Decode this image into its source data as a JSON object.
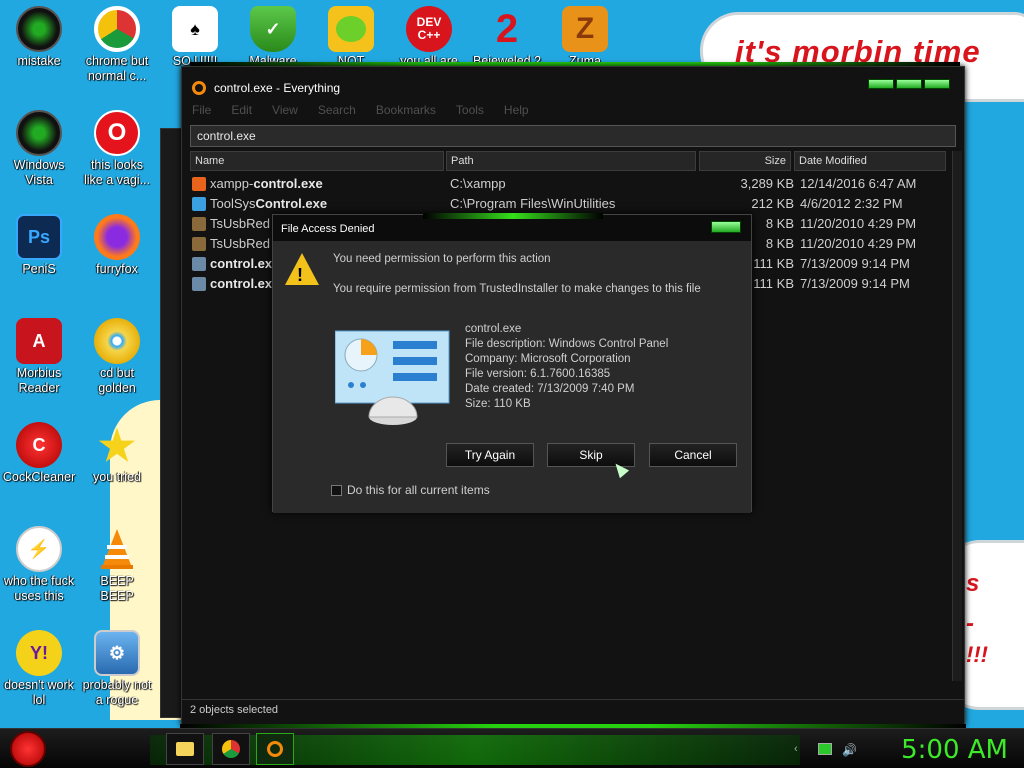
{
  "desktop": {
    "cloud_text": "it's morbin time",
    "cloud2_lines": [
      "s",
      "-",
      "!!!"
    ],
    "icons": [
      {
        "label": "mistake",
        "x": 0,
        "y": 0
      },
      {
        "label": "chrome but\nnormal c..."
      },
      {
        "label": "SO U!!!!"
      },
      {
        "label": "Malware"
      },
      {
        "label": "NOT"
      },
      {
        "label": "you all are"
      },
      {
        "label": "Bejeweled 2"
      },
      {
        "label": "Zuma"
      },
      {
        "label": "Windows\nVista"
      },
      {
        "label": "this looks\nlike a vagi..."
      },
      {
        "label": "PeniS"
      },
      {
        "label": "furryfox"
      },
      {
        "label": "Morbius\nReader"
      },
      {
        "label": "cd but\ngolden"
      },
      {
        "label": "CockCleaner"
      },
      {
        "label": "you tried"
      },
      {
        "label": "who the fuck\nuses this"
      },
      {
        "label": "BEEP\nBEEP"
      },
      {
        "label": "doesn't work\nlol"
      },
      {
        "label": "probably not\na rogue"
      }
    ]
  },
  "everything": {
    "title": "control.exe - Everything",
    "menu": [
      "File",
      "Edit",
      "View",
      "Search",
      "Bookmarks",
      "Tools",
      "Help"
    ],
    "search_value": "control.exe",
    "columns": {
      "name": "Name",
      "path": "Path",
      "size": "Size",
      "date": "Date Modified"
    },
    "rows": [
      {
        "name_pre": "xampp-",
        "name_bold": "control.exe",
        "path": "C:\\xampp",
        "size": "3,289 KB",
        "date": "12/14/2016 6:47 AM",
        "color": "#e8641c"
      },
      {
        "name_pre": "ToolSys",
        "name_bold": "Control.exe",
        "path": "C:\\Program Files\\WinUtilities",
        "size": "212 KB",
        "date": "4/6/2012 2:32 PM",
        "color": "#3aa0e0"
      },
      {
        "name_pre": "TsUsbRed",
        "name_bold": "",
        "path": "",
        "size": "8 KB",
        "date": "11/20/2010 4:29 PM",
        "color": "#8a6a3a"
      },
      {
        "name_pre": "TsUsbRed",
        "name_bold": "",
        "path": "",
        "size": "8 KB",
        "date": "11/20/2010 4:29 PM",
        "color": "#8a6a3a"
      },
      {
        "name_pre": "",
        "name_bold": "control.ex",
        "path": "",
        "size": "111 KB",
        "date": "7/13/2009 9:14 PM",
        "color": "#6a8aa8"
      },
      {
        "name_pre": "",
        "name_bold": "control.ex",
        "path": "",
        "size": "111 KB",
        "date": "7/13/2009 9:14 PM",
        "color": "#6a8aa8"
      }
    ],
    "status": "2 objects selected"
  },
  "dialog": {
    "title": "File Access Denied",
    "line1": "You need permission to perform this action",
    "line2": "You require permission from TrustedInstaller to make changes to this file",
    "file_name": "control.exe",
    "desc": "File description: Windows Control Panel",
    "company": "Company: Microsoft Corporation",
    "version": "File version: 6.1.7600.16385",
    "created": "Date created: 7/13/2009 7:40 PM",
    "size": "Size: 110 KB",
    "btn_try": "Try Again",
    "btn_skip": "Skip",
    "btn_cancel": "Cancel",
    "checkbox_label": "Do this for all current items"
  },
  "taskbar": {
    "clock": "5:00 AM"
  },
  "colors": {
    "accent_green": "#26d10f",
    "cloud_red": "#d8141c",
    "desktop_blue": "#22a8e0"
  }
}
